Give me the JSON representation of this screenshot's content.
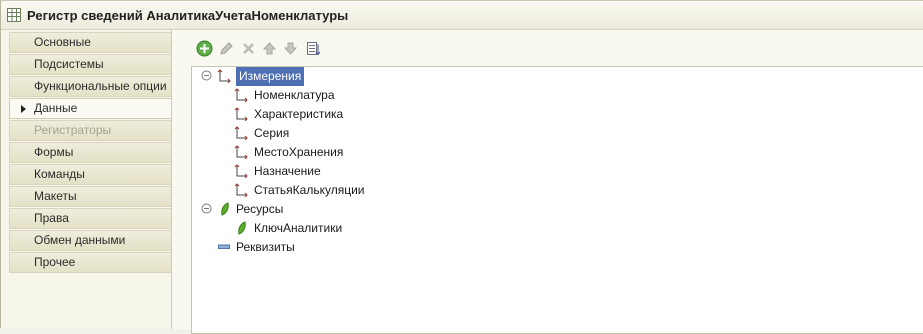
{
  "window": {
    "title": "Регистр сведений АналитикаУчетаНоменклатуры"
  },
  "sidebar": {
    "items": [
      {
        "label": "Основные",
        "state": "normal"
      },
      {
        "label": "Подсистемы",
        "state": "normal"
      },
      {
        "label": "Функциональные опции",
        "state": "normal"
      },
      {
        "label": "Данные",
        "state": "active"
      },
      {
        "label": "Регистраторы",
        "state": "disabled"
      },
      {
        "label": "Формы",
        "state": "normal"
      },
      {
        "label": "Команды",
        "state": "normal"
      },
      {
        "label": "Макеты",
        "state": "normal"
      },
      {
        "label": "Права",
        "state": "normal"
      },
      {
        "label": "Обмен данными",
        "state": "normal"
      },
      {
        "label": "Прочее",
        "state": "normal"
      }
    ]
  },
  "toolbar": {
    "icons": [
      "add-icon",
      "edit-icon",
      "delete-icon",
      "move-up-icon",
      "move-down-icon",
      "sort-icon"
    ]
  },
  "tree": {
    "groups": [
      {
        "label": "Измерения",
        "icon": "dimension-icon",
        "selected": true,
        "children": [
          "Номенклатура",
          "Характеристика",
          "Серия",
          "МестоХранения",
          "Назначение",
          "СтатьяКалькуляции"
        ]
      },
      {
        "label": "Ресурсы",
        "icon": "resource-icon",
        "children": [
          "КлючАналитики"
        ]
      },
      {
        "label": "Реквизиты",
        "icon": "attribute-icon",
        "children": []
      }
    ]
  },
  "colors": {
    "selection": "#4f6fb4",
    "dimension_icon": "#a8322b",
    "resource_icon": "#4c9a1c",
    "add_icon": "#3e9a32"
  }
}
